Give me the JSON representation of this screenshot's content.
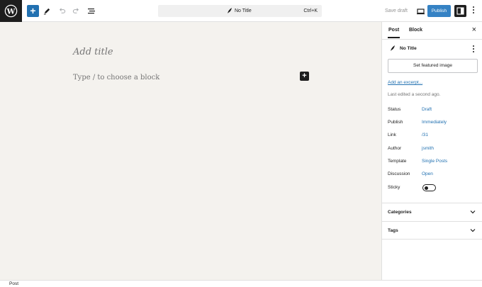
{
  "topbar": {
    "inserter_icon": "plus-icon",
    "tools_icon": "pencil-icon",
    "undo_icon": "undo-icon",
    "redo_icon": "redo-icon",
    "outline_icon": "list-view-icon",
    "command_bar": {
      "icon": "feather-icon",
      "title": "No Title",
      "shortcut": "Ctrl+K"
    },
    "save_draft": "Save draft",
    "preview_icon": "desktop-icon",
    "publish": "Publish",
    "settings_icon": "sidebar-icon",
    "options_icon": "more-vertical-icon"
  },
  "canvas": {
    "title_placeholder": "Add title",
    "block_placeholder": "Type / to choose a block",
    "block_inserter_icon": "plus-icon"
  },
  "sidebar": {
    "tabs": [
      {
        "label": "Post",
        "active": true
      },
      {
        "label": "Block",
        "active": false
      }
    ],
    "close_icon": "close-icon",
    "doc": {
      "icon": "feather-icon",
      "title": "No Title"
    },
    "featured_image_button": "Set featured image",
    "excerpt_link": "Add an excerpt...",
    "last_edited": "Last edited a second ago.",
    "meta": [
      {
        "label": "Status",
        "value": "Draft"
      },
      {
        "label": "Publish",
        "value": "Immediately"
      },
      {
        "label": "Link",
        "value": "/31"
      },
      {
        "label": "Author",
        "value": "jsmith"
      },
      {
        "label": "Template",
        "value": "Single Posts"
      },
      {
        "label": "Discussion",
        "value": "Open"
      }
    ],
    "sticky": {
      "label": "Sticky",
      "checked": false
    },
    "panels": [
      {
        "label": "Categories"
      },
      {
        "label": "Tags"
      }
    ]
  },
  "footer": {
    "breadcrumb": "Post"
  },
  "colors": {
    "accent": "#2271b1",
    "publish_bg": "#3582c4",
    "canvas_bg": "#f4f2ee",
    "dark": "#1e1e1e"
  }
}
